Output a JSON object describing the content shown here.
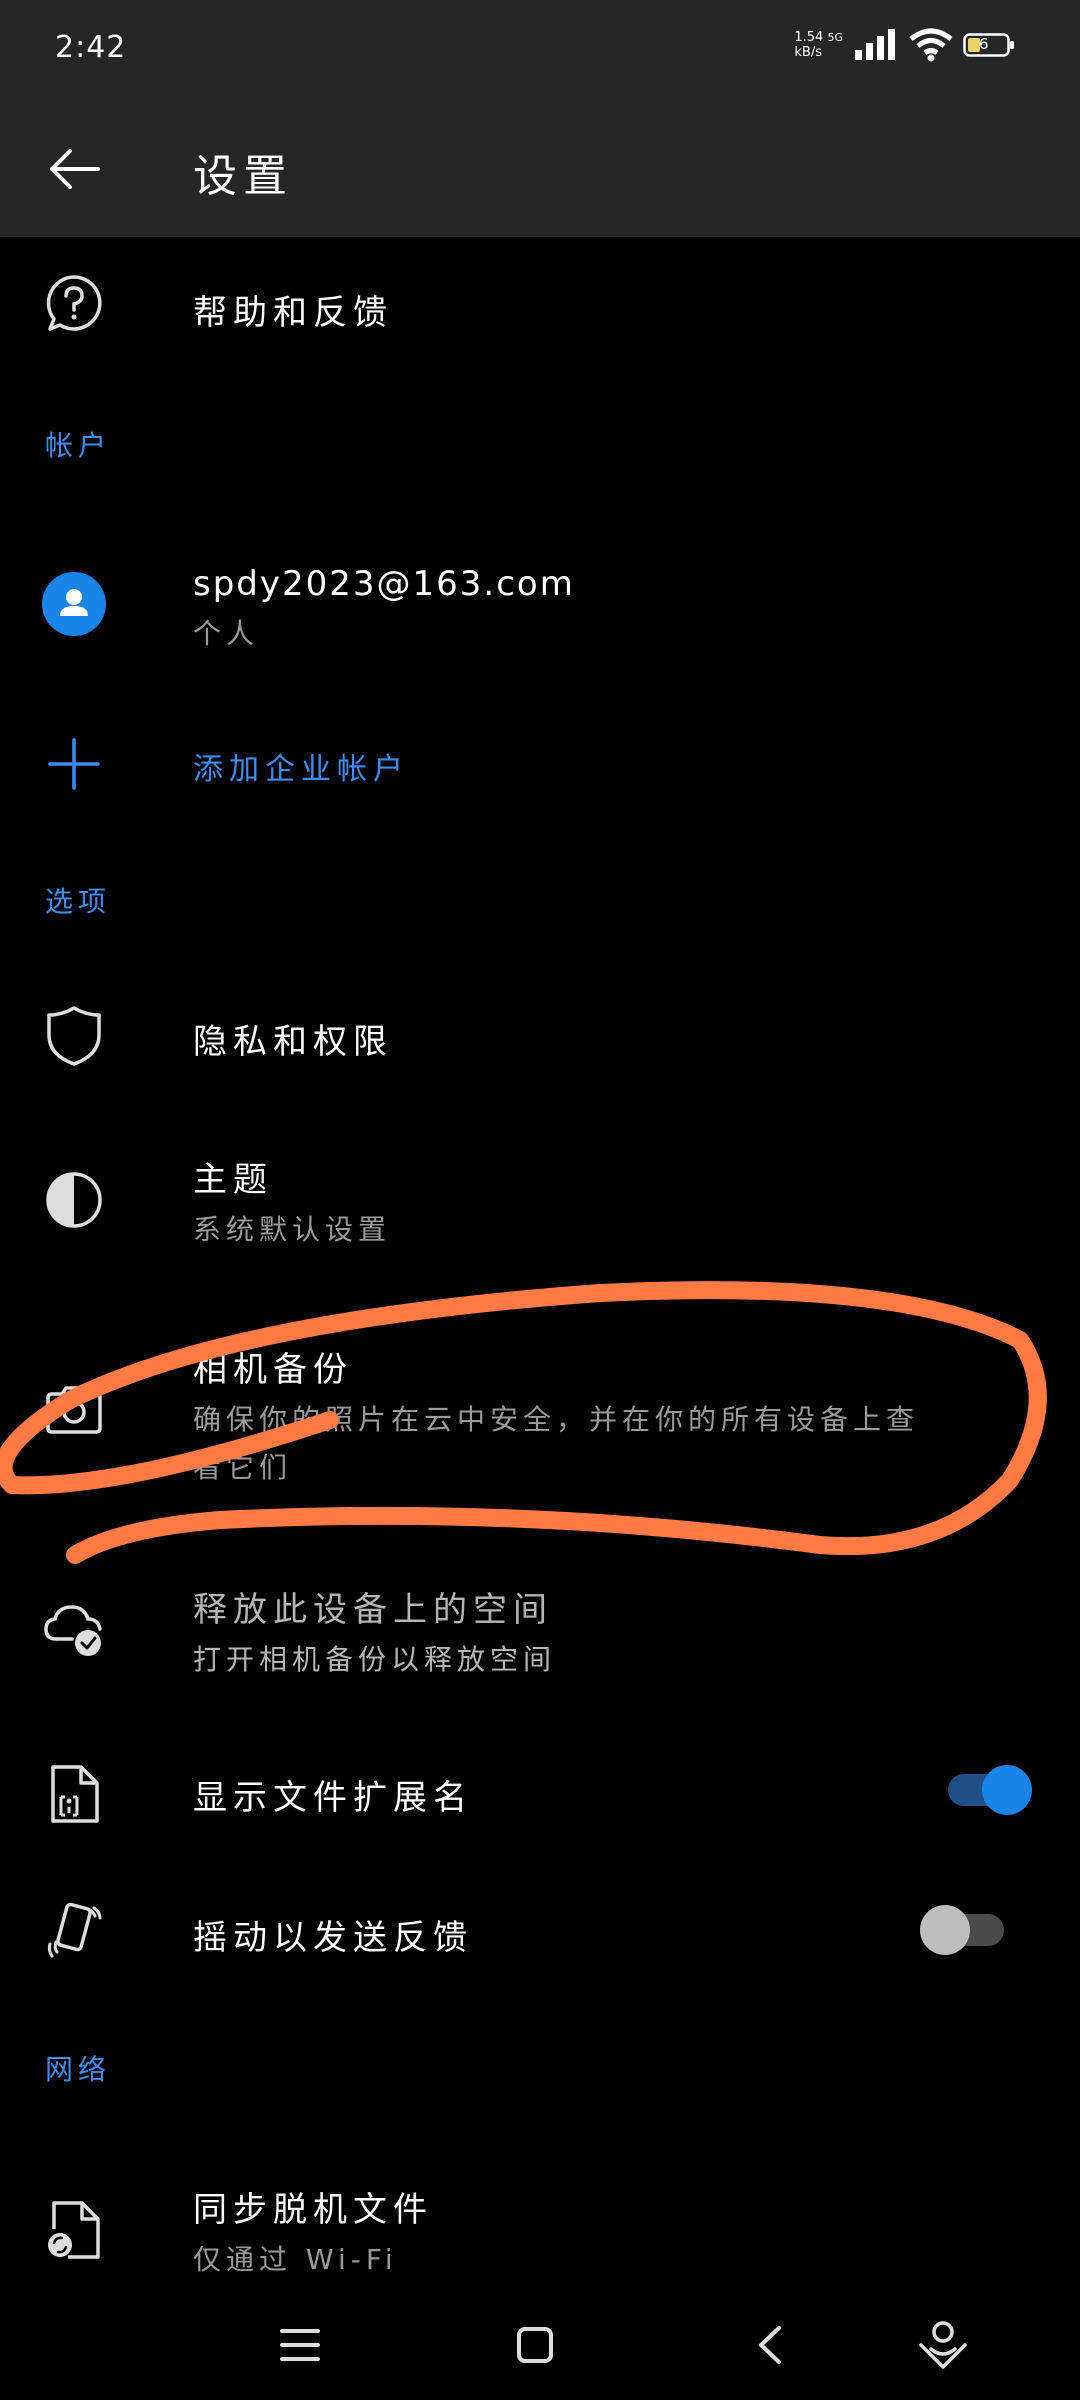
{
  "status_bar": {
    "time": "2:42",
    "net_speed_value": "1.54",
    "net_speed_unit": "kB/s",
    "network_type": "5G",
    "battery_level": "6"
  },
  "header": {
    "title": "设置"
  },
  "help": {
    "label": "帮助和反馈"
  },
  "accounts": {
    "section_label": "帐户",
    "email": "spdy2023@163.com",
    "account_type": "个人",
    "add_business_label": "添加企业帐户"
  },
  "options": {
    "section_label": "选项",
    "privacy_label": "隐私和权限",
    "theme_label": "主题",
    "theme_value": "系统默认设置",
    "camera_backup_label": "相机备份",
    "camera_backup_desc_line1": "确保你的照片在云中安全，并在你的所有设备上查",
    "camera_backup_desc_line2": "看它们",
    "free_space_label": "释放此设备上的空间",
    "free_space_desc": "打开相机备份以释放空间",
    "file_ext_label": "显示文件扩展名",
    "file_ext_enabled": true,
    "shake_label": "摇动以发送反馈",
    "shake_enabled": false
  },
  "network": {
    "section_label": "网络",
    "sync_label": "同步脱机文件",
    "sync_value": "仅通过 Wi-Fi"
  },
  "colors": {
    "accent": "#3d8ef0",
    "toggle_on": "#1a84e8",
    "annotation": "#ff7a45",
    "bar_bg": "#262626"
  }
}
